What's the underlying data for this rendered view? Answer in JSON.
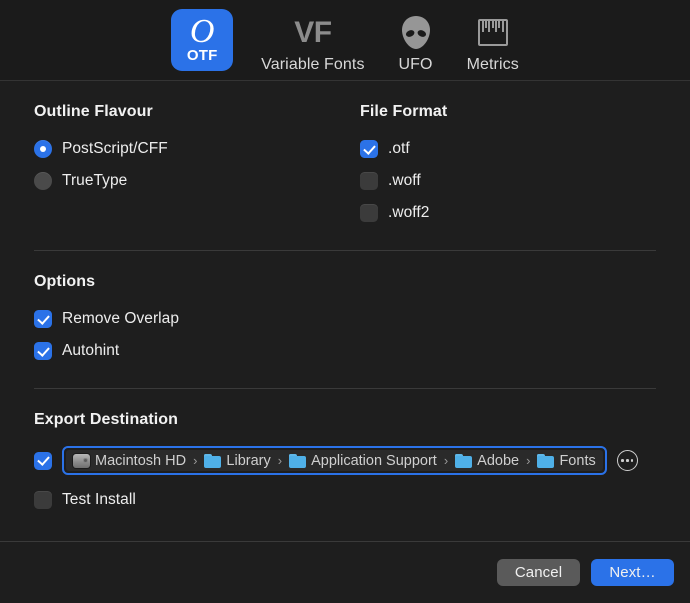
{
  "toolbar": {
    "tabs": [
      {
        "label": "OTF",
        "icon": "otf-icon",
        "glyph": "O",
        "active": true
      },
      {
        "label": "Variable Fonts",
        "icon": "vf-icon",
        "glyph": "VF",
        "active": false
      },
      {
        "label": "UFO",
        "icon": "alien-icon",
        "glyph": "",
        "active": false
      },
      {
        "label": "Metrics",
        "icon": "ruler-icon",
        "glyph": "",
        "active": false
      }
    ]
  },
  "outline_flavour": {
    "title": "Outline Flavour",
    "options": [
      {
        "label": "PostScript/CFF",
        "selected": true
      },
      {
        "label": "TrueType",
        "selected": false
      }
    ]
  },
  "file_format": {
    "title": "File Format",
    "options": [
      {
        "label": ".otf",
        "checked": true
      },
      {
        "label": ".woff",
        "checked": false
      },
      {
        "label": ".woff2",
        "checked": false
      }
    ]
  },
  "options": {
    "title": "Options",
    "items": [
      {
        "label": "Remove Overlap",
        "checked": true
      },
      {
        "label": "Autohint",
        "checked": true
      }
    ]
  },
  "export_destination": {
    "title": "Export Destination",
    "enabled": true,
    "path_segments": [
      {
        "label": "Macintosh HD",
        "icon": "harddisk-icon"
      },
      {
        "label": "Library",
        "icon": "folder-icon"
      },
      {
        "label": "Application Support",
        "icon": "folder-icon"
      },
      {
        "label": "Adobe",
        "icon": "folder-icon"
      },
      {
        "label": "Fonts",
        "icon": "folder-icon"
      }
    ],
    "separator": "›",
    "more_button": "ellipsis-icon",
    "test_install": {
      "label": "Test Install",
      "checked": false
    }
  },
  "footer": {
    "cancel_label": "Cancel",
    "next_label": "Next…"
  },
  "colors": {
    "accent": "#2b72e8",
    "background": "#1e1e1e",
    "toolbar_background": "#1b1b1b",
    "divider": "#3a3a3a",
    "control_off": "#3b3b3b",
    "secondary_button": "#5a5a5a",
    "folder_blue": "#4fb0e8"
  }
}
